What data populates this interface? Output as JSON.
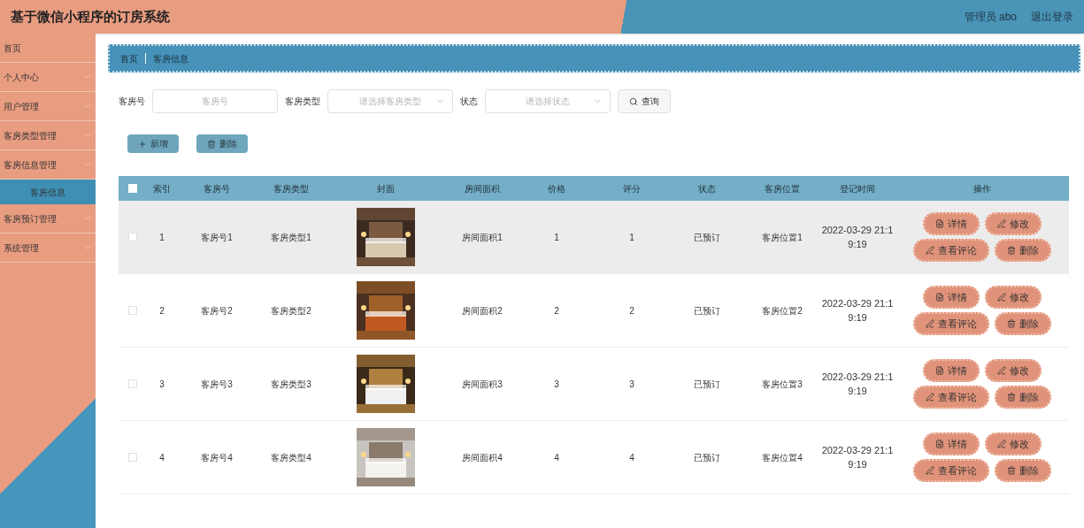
{
  "header": {
    "title": "基于微信小程序的订房系统",
    "user": "管理员 abo",
    "logout": "退出登录"
  },
  "sidebar": {
    "items": [
      {
        "label": "首页",
        "expandable": false,
        "selected": false
      },
      {
        "label": "个人中心",
        "expandable": true,
        "selected": false
      },
      {
        "label": "用户管理",
        "expandable": true,
        "selected": false
      },
      {
        "label": "客房类型管理",
        "expandable": true,
        "selected": false
      },
      {
        "label": "客房信息管理",
        "expandable": true,
        "selected": false,
        "children": [
          {
            "label": "客房信息",
            "selected": true
          }
        ]
      },
      {
        "label": "客房预订管理",
        "expandable": true,
        "selected": false
      },
      {
        "label": "系统管理",
        "expandable": true,
        "selected": false
      }
    ]
  },
  "breadcrumb": [
    "首页",
    "客房信息"
  ],
  "filters": [
    {
      "kind": "input",
      "label": "客房号",
      "placeholder": "客房号"
    },
    {
      "kind": "select",
      "label": "客房类型",
      "placeholder": "请选择客房类型"
    },
    {
      "kind": "select",
      "label": "状态",
      "placeholder": "请选择状态"
    }
  ],
  "search_button": "查询",
  "actions": [
    {
      "kind": "add",
      "label": "新增"
    },
    {
      "kind": "delete",
      "label": "删除"
    }
  ],
  "table": {
    "header_checked": false,
    "columns": [
      "索引",
      "客房号",
      "客房类型",
      "封面",
      "房间面积",
      "价格",
      "评分",
      "状态",
      "客房位置",
      "登记时间",
      "操作"
    ],
    "rows": [
      {
        "checked": false,
        "hovered": true,
        "index": "1",
        "room_no": "客房号1",
        "room_type": "客房类型1",
        "area": "房间面积1",
        "price": "1",
        "score": "1",
        "status": "已预订",
        "location": "客房位置1",
        "time": "2022-03-29 21:19:19",
        "ops": [
          "详情",
          "修改",
          "查看评论",
          "删除"
        ]
      },
      {
        "checked": false,
        "hovered": false,
        "index": "2",
        "room_no": "客房号2",
        "room_type": "客房类型2",
        "area": "房间面积2",
        "price": "2",
        "score": "2",
        "status": "已预订",
        "location": "客房位置2",
        "time": "2022-03-29 21:19:19",
        "ops": [
          "详情",
          "修改",
          "查看评论",
          "删除"
        ]
      },
      {
        "checked": false,
        "hovered": false,
        "index": "3",
        "room_no": "客房号3",
        "room_type": "客房类型3",
        "area": "房间面积3",
        "price": "3",
        "score": "3",
        "status": "已预订",
        "location": "客房位置3",
        "time": "2022-03-29 21:19:19",
        "ops": [
          "详情",
          "修改",
          "查看评论",
          "删除"
        ]
      },
      {
        "checked": false,
        "hovered": false,
        "index": "4",
        "room_no": "客房号4",
        "room_type": "客房类型4",
        "area": "房间面积4",
        "price": "4",
        "score": "4",
        "status": "已预订",
        "location": "客房位置4",
        "time": "2022-03-29 21:19:19",
        "ops": [
          "详情",
          "修改",
          "查看评论",
          "删除"
        ]
      }
    ]
  }
}
